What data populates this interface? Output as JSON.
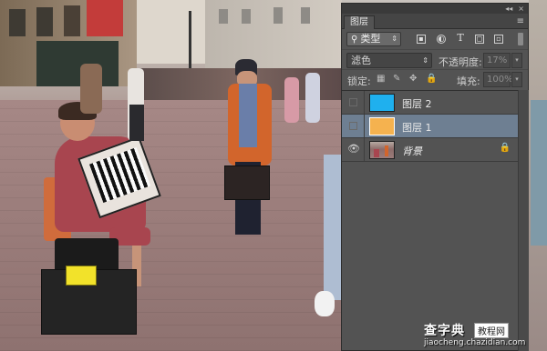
{
  "panel": {
    "title_controls": [
      "◂◂",
      "×"
    ],
    "tab_label": "图层",
    "menu_icon": "≡",
    "filter": {
      "kind_label": "类型",
      "kind_icon": "search-icon",
      "type_icons": [
        "image-filter-icon",
        "adjustment-filter-icon",
        "text-filter-icon",
        "shape-filter-icon",
        "smart-object-filter-icon"
      ]
    },
    "blend_mode": "滤色",
    "opacity_label": "不透明度:",
    "opacity_value": "17%",
    "lock_label": "锁定:",
    "fill_label": "填充:",
    "fill_value": "100%",
    "layers": [
      {
        "name": "图层 2",
        "color": "#1fb0ee",
        "visible": false,
        "selected": false
      },
      {
        "name": "图层 1",
        "color": "#f5b24f",
        "visible": false,
        "selected": true
      },
      {
        "name": "背景",
        "thumb": "photo",
        "visible": true,
        "locked": true,
        "selected": false
      }
    ]
  },
  "watermark": {
    "title": "查字典",
    "badge": "教程网",
    "url": "jiaocheng.chazidian.com"
  }
}
